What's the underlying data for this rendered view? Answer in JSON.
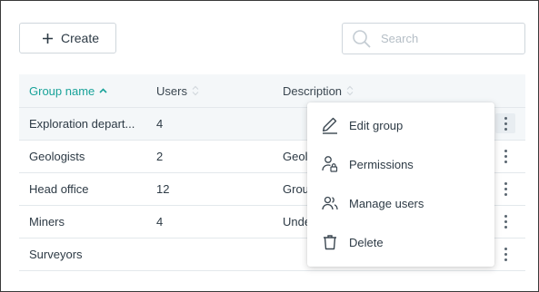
{
  "toolbar": {
    "create_label": "Create",
    "search_placeholder": "Search"
  },
  "table": {
    "columns": {
      "name": "Group name",
      "users": "Users",
      "description": "Description"
    },
    "rows": [
      {
        "name": "Exploration depart...",
        "users": "4",
        "description": ""
      },
      {
        "name": "Geologists",
        "users": "2",
        "description": "Geolo"
      },
      {
        "name": "Head office",
        "users": "12",
        "description": "Grou"
      },
      {
        "name": "Miners",
        "users": "4",
        "description": "Unde"
      },
      {
        "name": "Surveyors",
        "users": "",
        "description": ""
      }
    ]
  },
  "menu": {
    "items": [
      {
        "label": "Edit group",
        "icon": "pencil-icon"
      },
      {
        "label": "Permissions",
        "icon": "user-lock-icon"
      },
      {
        "label": "Manage users",
        "icon": "users-icon"
      },
      {
        "label": "Delete",
        "icon": "trash-icon"
      }
    ]
  },
  "colors": {
    "accent": "#1aa39a",
    "header_bg": "#f4f7f9",
    "border": "#cfd6dc"
  }
}
